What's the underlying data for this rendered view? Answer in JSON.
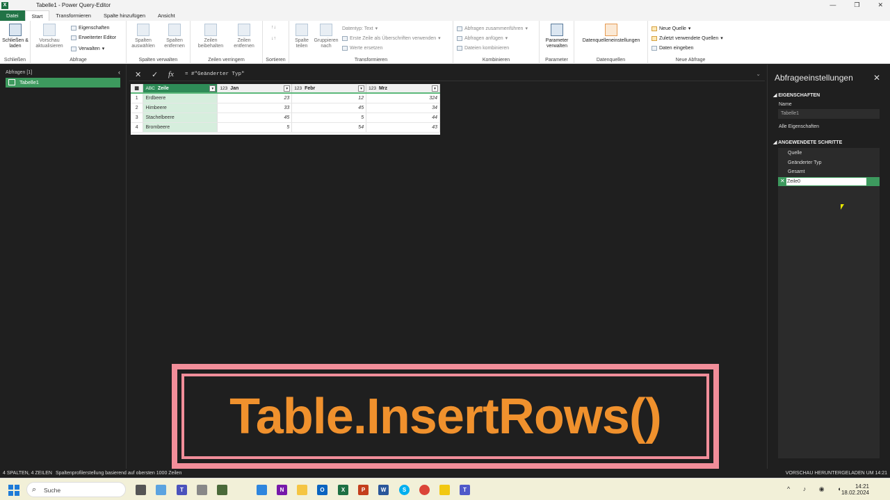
{
  "window": {
    "title": "Tabelle1 - Power Query-Editor"
  },
  "tabs": [
    "Datei",
    "Start",
    "Transformieren",
    "Spalte hinzufügen",
    "Ansicht"
  ],
  "ribbon": {
    "close_load": "Schließen & laden",
    "close_group": "Schließen",
    "preview_refresh": "Vorschau aktualisieren",
    "properties": "Eigenschaften",
    "advanced_editor": "Erweiterter Editor",
    "manage": "Verwalten",
    "query_group": "Abfrage",
    "choose_columns": "Spalten auswählen",
    "remove_columns": "Spalten entfernen",
    "manage_columns_group": "Spalten verwalten",
    "keep_rows": "Zeilen beibehalten",
    "remove_rows": "Zeilen entfernen",
    "reduce_rows_group": "Zeilen verringern",
    "sort_group": "Sortieren",
    "split_column": "Spalte teilen",
    "group_by": "Gruppieren nach",
    "datatype": "Datentyp: Text",
    "first_row_headers": "Erste Zeile als Überschriften verwenden",
    "replace_values": "Werte ersetzen",
    "transform_group": "Transformieren",
    "merge_queries": "Abfragen zusammenführen",
    "append_queries": "Abfragen anfügen",
    "combine_files": "Dateien kombinieren",
    "combine_group": "Kombinieren",
    "manage_parameters": "Parameter verwalten",
    "parameter_group": "Parameter",
    "datasource_settings": "Datenquelleneinstellungen",
    "datasources_group": "Datenquellen",
    "new_source": "Neue Quelle",
    "recent_sources": "Zuletzt verwendete Quellen",
    "enter_data": "Daten eingeben",
    "new_query_group": "Neue Abfrage"
  },
  "queries": {
    "header": "Abfragen [1]",
    "items": [
      "Tabelle1"
    ]
  },
  "formula": {
    "text": "= #\"Geänderter Typ\""
  },
  "grid": {
    "columns": [
      {
        "type": "ABC",
        "name": "Zeile"
      },
      {
        "type": "123",
        "name": "Jan"
      },
      {
        "type": "123",
        "name": "Febr"
      },
      {
        "type": "123",
        "name": "Mrz"
      }
    ],
    "rows": [
      {
        "n": "1",
        "c": [
          "Erdbeere",
          "23",
          "12",
          "324"
        ]
      },
      {
        "n": "2",
        "c": [
          "Himbeere",
          "33",
          "45",
          "34"
        ]
      },
      {
        "n": "3",
        "c": [
          "Stachelbeere",
          "45",
          "5",
          "44"
        ]
      },
      {
        "n": "4",
        "c": [
          "Brombeere",
          "5",
          "54",
          "43"
        ]
      }
    ]
  },
  "settings": {
    "title": "Abfrageeinstellungen",
    "props_header": "EIGENSCHAFTEN",
    "name_label": "Name",
    "name_value": "Tabelle1",
    "all_props": "Alle Eigenschaften",
    "steps_header": "ANGEWENDETE SCHRITTE",
    "steps": [
      "Quelle",
      "Geänderter Typ",
      "Gesamt"
    ],
    "editing_step": "Zeile0"
  },
  "status": {
    "left": "4 SPALTEN, 4 ZEILEN",
    "profiling": "Spaltenprofilerstellung basierend auf obersten 1000 Zeilen",
    "right": "VORSCHAU HERUNTERGELADEN UM 14:21"
  },
  "banner": {
    "text": "Table.InsertRows()"
  },
  "taskbar": {
    "search": "Suche",
    "time": "14:21",
    "date": "18.02.2024"
  }
}
